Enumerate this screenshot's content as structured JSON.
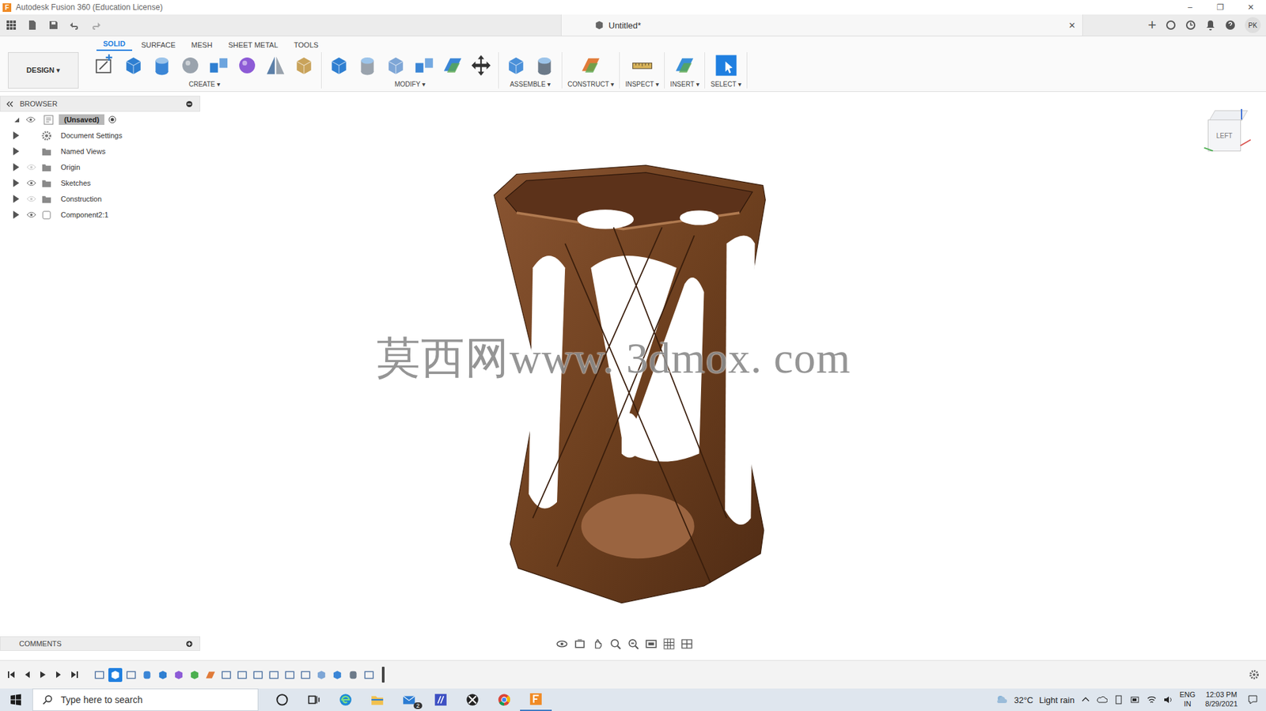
{
  "window": {
    "logo": "F",
    "title": "Autodesk Fusion 360 (Education License)",
    "controls": [
      "–",
      "❐",
      "✕"
    ]
  },
  "appbar": {
    "document": {
      "title": "Untitled*",
      "close": "✕"
    },
    "new_tab": "+",
    "avatar": "PK"
  },
  "caret": "▾",
  "ribbon": {
    "workspace": "DESIGN",
    "tabs": [
      {
        "label": "SOLID",
        "selected": true
      },
      {
        "label": "SURFACE",
        "selected": false
      },
      {
        "label": "MESH",
        "selected": false
      },
      {
        "label": "SHEET METAL",
        "selected": false
      },
      {
        "label": "TOOLS",
        "selected": false
      }
    ],
    "groups": [
      {
        "label": "CREATE",
        "tools": [
          "sketch",
          "extrude",
          "revolve",
          "hole",
          "pattern",
          "form",
          "mirror",
          "decal"
        ]
      },
      {
        "label": "MODIFY",
        "tools": [
          "presspull",
          "fillet",
          "shell",
          "combine",
          "offset",
          "move"
        ]
      },
      {
        "label": "ASSEMBLE",
        "tools": [
          "component",
          "joint"
        ]
      },
      {
        "label": "CONSTRUCT",
        "tools": [
          "plane"
        ]
      },
      {
        "label": "INSPECT",
        "tools": [
          "measure"
        ]
      },
      {
        "label": "INSERT",
        "tools": [
          "image"
        ]
      },
      {
        "label": "SELECT",
        "tools": [
          "select"
        ]
      }
    ]
  },
  "browser": {
    "title": "BROWSER",
    "root": {
      "label": "(Unsaved)",
      "expanded": true,
      "selected": true
    },
    "items": [
      {
        "label": "Document Settings",
        "kind": "settings",
        "expanded": false,
        "eye": false,
        "visible": true
      },
      {
        "label": "Named Views",
        "kind": "folder",
        "expanded": false,
        "eye": false,
        "visible": true
      },
      {
        "label": "Origin",
        "kind": "folder",
        "expanded": false,
        "eye": true,
        "visible": false
      },
      {
        "label": "Sketches",
        "kind": "folder",
        "expanded": false,
        "eye": true,
        "visible": true
      },
      {
        "label": "Construction",
        "kind": "folder",
        "expanded": false,
        "eye": true,
        "visible": false
      },
      {
        "label": "Component2:1",
        "kind": "component",
        "expanded": false,
        "eye": true,
        "visible": true
      }
    ]
  },
  "viewport": {
    "watermark": "莫西网www. 3dmox. com",
    "viewcube": "LEFT"
  },
  "comments": {
    "title": "COMMENTS"
  },
  "timeline": {
    "features": [
      {
        "kind": "sketch",
        "selected": false
      },
      {
        "kind": "extrude",
        "selected": true
      },
      {
        "kind": "sketch",
        "selected": false
      },
      {
        "kind": "revolve",
        "selected": false
      },
      {
        "kind": "extrude",
        "selected": false
      },
      {
        "kind": "form",
        "selected": false
      },
      {
        "kind": "loft",
        "selected": false
      },
      {
        "kind": "plane",
        "selected": false
      },
      {
        "kind": "sketch",
        "selected": false
      },
      {
        "kind": "sketch",
        "selected": false
      },
      {
        "kind": "sketch",
        "selected": false
      },
      {
        "kind": "sketch",
        "selected": false
      },
      {
        "kind": "sketch",
        "selected": false
      },
      {
        "kind": "sketch",
        "selected": false
      },
      {
        "kind": "shell",
        "selected": false
      },
      {
        "kind": "combine",
        "selected": false
      },
      {
        "kind": "joint",
        "selected": false
      },
      {
        "kind": "sketch",
        "selected": false
      }
    ]
  },
  "taskbar": {
    "search": "Type here to search",
    "mail_badge": "2",
    "weather": {
      "temp": "32°C",
      "text": "Light rain"
    },
    "language": [
      "ENG",
      "IN"
    ],
    "time": "12:03 PM",
    "date": "8/29/2021"
  }
}
